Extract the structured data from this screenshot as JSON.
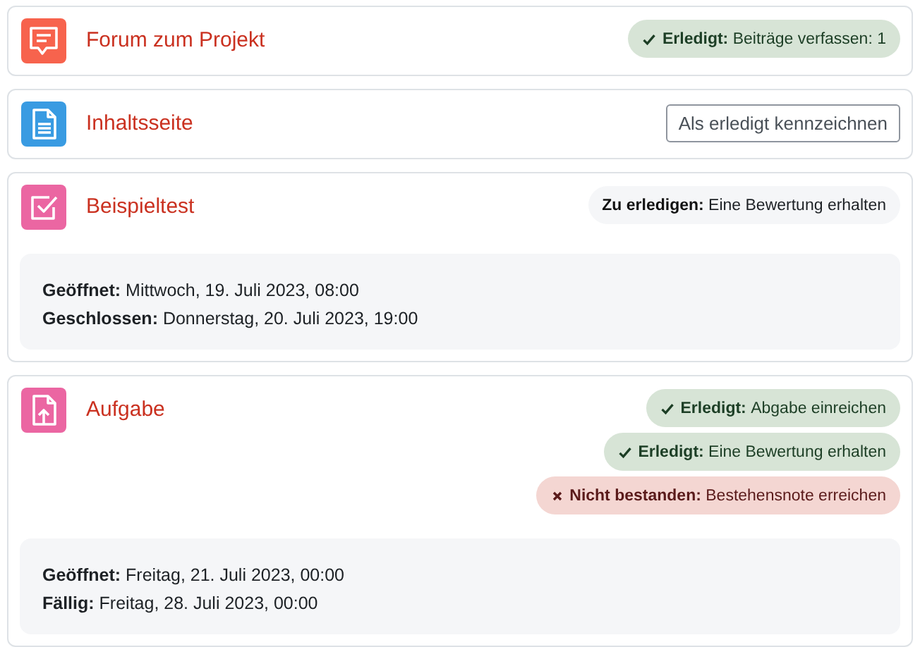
{
  "activities": [
    {
      "kind": "forum",
      "color": "#f7634d",
      "title": "Forum zum Projekt",
      "completions": [
        {
          "kind": "done",
          "label": "Erledigt:",
          "text": "Beiträge verfassen: 1"
        }
      ]
    },
    {
      "kind": "page",
      "color": "#399be2",
      "title": "Inhaltsseite",
      "button": "Als erledigt kennzeichnen"
    },
    {
      "kind": "quiz",
      "color": "#eb66a2",
      "title": "Beispieltest",
      "completions": [
        {
          "kind": "todo",
          "label": "Zu erledigen:",
          "text": "Eine Bewertung erhalten"
        }
      ],
      "dates": [
        {
          "label": "Geöffnet:",
          "value": "Mittwoch, 19. Juli 2023, 08:00"
        },
        {
          "label": "Geschlossen:",
          "value": "Donnerstag, 20. Juli 2023, 19:00"
        }
      ]
    },
    {
      "kind": "assign",
      "color": "#eb66a2",
      "title": "Aufgabe",
      "completions": [
        {
          "kind": "done",
          "label": "Erledigt:",
          "text": "Abgabe einreichen"
        },
        {
          "kind": "done",
          "label": "Erledigt:",
          "text": "Eine Bewertung erhalten"
        },
        {
          "kind": "failed",
          "label": "Nicht bestanden:",
          "text": "Bestehensnote erreichen"
        }
      ],
      "dates": [
        {
          "label": "Geöffnet:",
          "value": "Freitag, 21. Juli 2023, 00:00"
        },
        {
          "label": "Fällig:",
          "value": "Freitag, 28. Juli 2023, 00:00"
        }
      ]
    }
  ]
}
